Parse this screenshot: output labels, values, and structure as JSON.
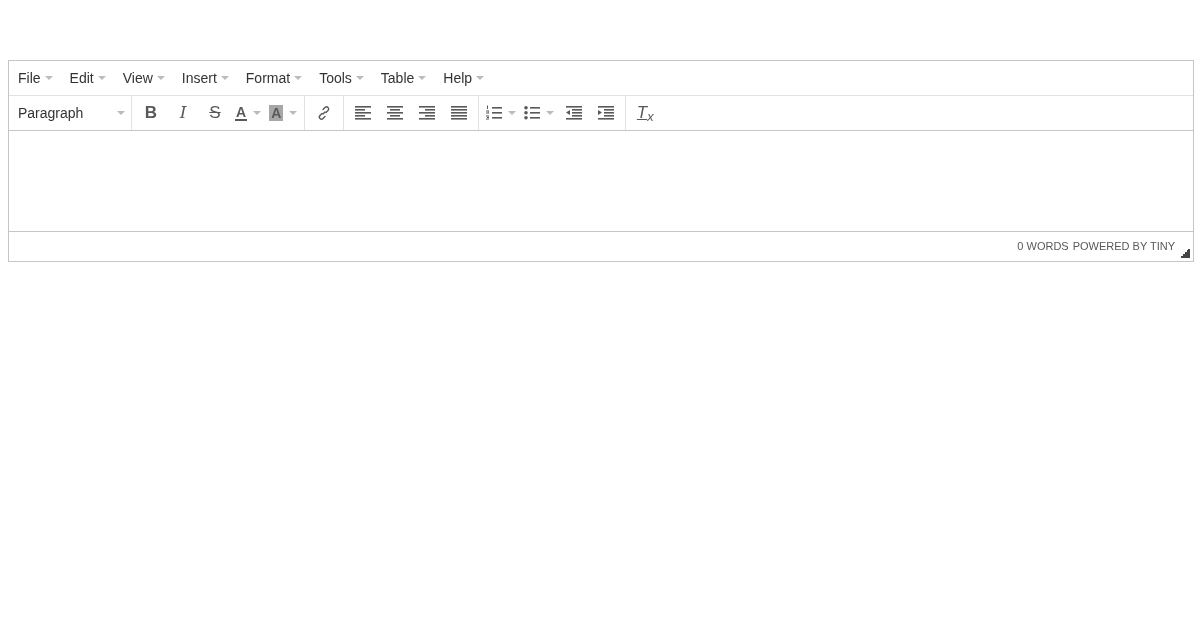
{
  "menubar": [
    {
      "label": "File"
    },
    {
      "label": "Edit"
    },
    {
      "label": "View"
    },
    {
      "label": "Insert"
    },
    {
      "label": "Format"
    },
    {
      "label": "Tools"
    },
    {
      "label": "Table"
    },
    {
      "label": "Help"
    }
  ],
  "toolbar": {
    "format_select": {
      "value": "Paragraph"
    },
    "groups": [
      [
        {
          "kind": "bold",
          "glyph": "B",
          "split": false
        },
        {
          "kind": "italic",
          "glyph": "I",
          "split": false
        },
        {
          "kind": "strike",
          "glyph": "S",
          "split": false
        },
        {
          "kind": "forecolor",
          "glyph": "A",
          "split": true
        },
        {
          "kind": "backcolor",
          "glyph": "A",
          "split": true
        }
      ],
      [
        {
          "kind": "link",
          "split": false
        }
      ],
      [
        {
          "kind": "align-left",
          "split": false
        },
        {
          "kind": "align-center",
          "split": false
        },
        {
          "kind": "align-right",
          "split": false
        },
        {
          "kind": "justify",
          "split": false
        }
      ],
      [
        {
          "kind": "numlist",
          "split": true
        },
        {
          "kind": "bullist",
          "split": true
        },
        {
          "kind": "outdent",
          "split": false
        },
        {
          "kind": "indent",
          "split": false
        }
      ],
      [
        {
          "kind": "clear-format",
          "glyph": "T$_{x}$",
          "split": false
        }
      ]
    ]
  },
  "status_bar": {
    "word_count": "0 WORDS",
    "branding": "POWERED BY TINY"
  }
}
